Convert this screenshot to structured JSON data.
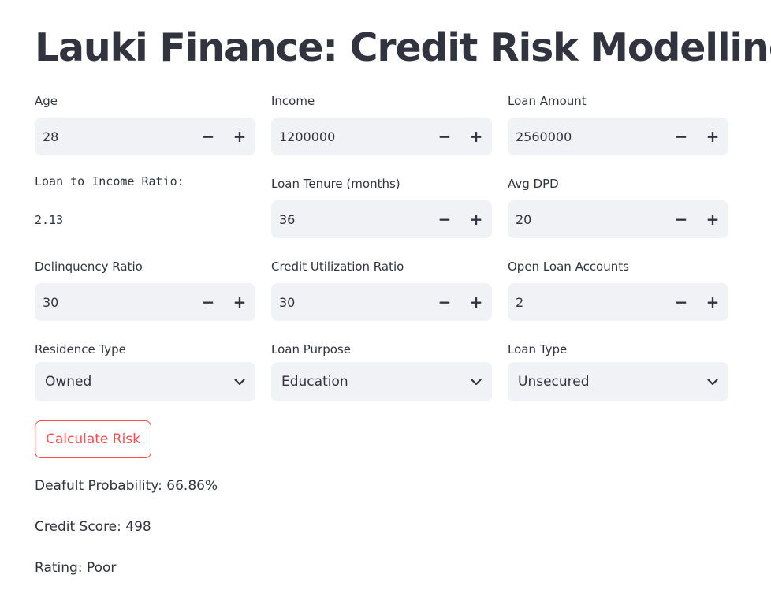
{
  "app": {
    "title": "Lauki Finance: Credit Risk Modelling"
  },
  "inputs": {
    "age": {
      "label": "Age",
      "value": "28"
    },
    "income": {
      "label": "Income",
      "value": "1200000"
    },
    "loan_amount": {
      "label": "Loan Amount",
      "value": "2560000"
    },
    "loan_tenure": {
      "label": "Loan Tenure (months)",
      "value": "36"
    },
    "avg_dpd": {
      "label": "Avg DPD",
      "value": "20"
    },
    "delinquency_ratio": {
      "label": "Delinquency Ratio",
      "value": "30"
    },
    "credit_utilization_ratio": {
      "label": "Credit Utilization Ratio",
      "value": "30"
    },
    "open_loan_accounts": {
      "label": "Open Loan Accounts",
      "value": "2"
    }
  },
  "selects": {
    "residence_type": {
      "label": "Residence Type",
      "value": "Owned"
    },
    "loan_purpose": {
      "label": "Loan Purpose",
      "value": "Education"
    },
    "loan_type": {
      "label": "Loan Type",
      "value": "Unsecured"
    }
  },
  "ratio": {
    "label": "Loan to Income Ratio:",
    "value": "2.13"
  },
  "stepper": {
    "minus": "−",
    "plus": "+"
  },
  "actions": {
    "calculate_label": "Calculate Risk"
  },
  "results": {
    "default_probability": "Deafult Probability: 66.86%",
    "credit_score": "Credit Score: 498",
    "rating": "Rating: Poor"
  },
  "icons": {
    "minus": "minus-icon",
    "plus": "plus-icon",
    "dropdown": "chevron-down-icon"
  },
  "colors": {
    "text": "#31333f",
    "input_bg": "#f0f2f6",
    "accent": "#ff4b4b"
  }
}
